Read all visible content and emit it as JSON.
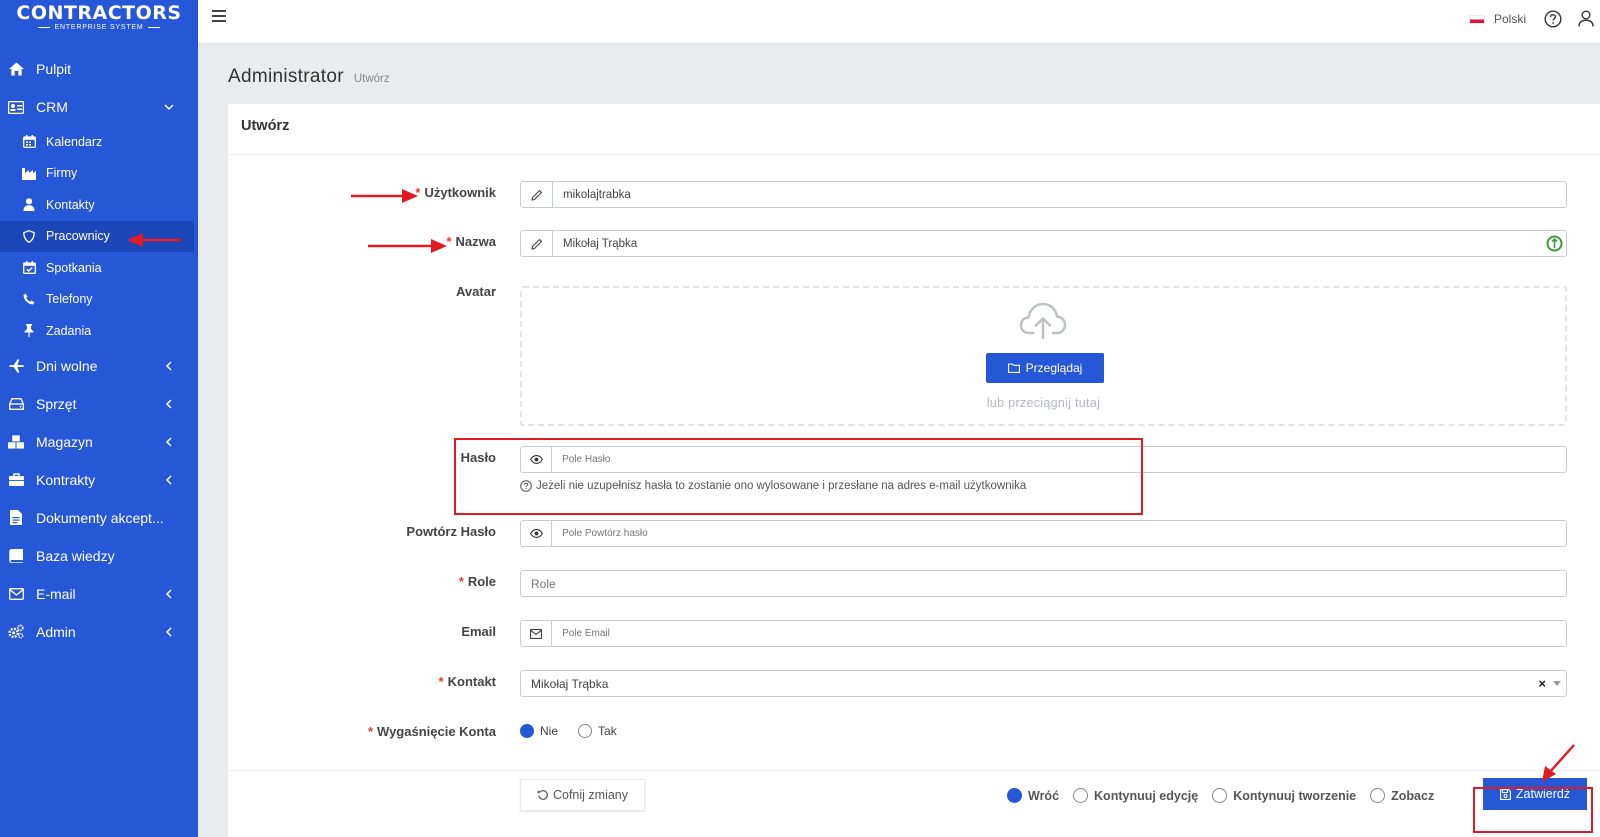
{
  "brand": {
    "name": "CONTRACTORS",
    "tagline": "ENTERPRISE SYSTEM"
  },
  "sidebar": {
    "items": [
      {
        "label": "Pulpit",
        "icon": "home-icon"
      },
      {
        "label": "CRM",
        "icon": "id-card-icon",
        "expanded": true
      },
      {
        "label": "Dni wolne",
        "icon": "plane-icon"
      },
      {
        "label": "Sprzęt",
        "icon": "hdd-icon"
      },
      {
        "label": "Magazyn",
        "icon": "boxes-icon"
      },
      {
        "label": "Kontrakty",
        "icon": "briefcase-icon"
      },
      {
        "label": "Dokumenty akcept...",
        "icon": "document-icon"
      },
      {
        "label": "Baza wiedzy",
        "icon": "book-icon"
      },
      {
        "label": "E-mail",
        "icon": "envelope-icon"
      },
      {
        "label": "Admin",
        "icon": "cogs-icon"
      }
    ],
    "crm_children": [
      {
        "label": "Kalendarz",
        "icon": "calendar-icon"
      },
      {
        "label": "Firmy",
        "icon": "industry-icon"
      },
      {
        "label": "Kontakty",
        "icon": "person-icon"
      },
      {
        "label": "Pracownicy",
        "icon": "shield-icon",
        "active": true
      },
      {
        "label": "Spotkania",
        "icon": "calendar-check-icon"
      },
      {
        "label": "Telefony",
        "icon": "phone-icon"
      },
      {
        "label": "Zadania",
        "icon": "thumbtack-icon"
      }
    ]
  },
  "topbar": {
    "language": "Polski",
    "flag_colors": [
      "#ffffff",
      "#dc143c"
    ]
  },
  "page": {
    "title": "Administrator",
    "subtitle": "Utwórz"
  },
  "card": {
    "title": "Utwórz"
  },
  "form": {
    "username": {
      "label": "Użytkownik",
      "value": "mikolajtrabka",
      "required": true
    },
    "name": {
      "label": "Nazwa",
      "value": "Mikołaj Trąbka",
      "required": true
    },
    "avatar": {
      "label": "Avatar",
      "browse_label": "Przeglądaj",
      "drop_hint": "lub przeciągnij tutaj"
    },
    "password": {
      "label": "Hasło",
      "placeholder": "Pole Hasło",
      "hint": "Jeżeli nie uzupełnisz hasła to zostanie ono wylosowane i przesłane na adres e-mail użytkownika"
    },
    "password_repeat": {
      "label": "Powtórz Hasło",
      "placeholder": "Pole Powtórz hasło"
    },
    "role": {
      "label": "Role",
      "placeholder": "Role",
      "required": true
    },
    "email": {
      "label": "Email",
      "placeholder": "Pole Email"
    },
    "contact": {
      "label": "Kontakt",
      "value": "Mikołaj Trąbka",
      "clear": "×",
      "required": true
    },
    "expiry": {
      "label": "Wygaśnięcie Konta",
      "required": true,
      "options": [
        "Nie",
        "Tak"
      ],
      "selected": "Nie"
    }
  },
  "footer": {
    "reset_label": "Cofnij zmiany",
    "after_save": {
      "options": [
        "Wróć",
        "Kontynuuj edycję",
        "Kontynuuj tworzenie",
        "Zobacz"
      ],
      "selected": "Wróć"
    },
    "submit_label": "Zatwierdź"
  },
  "colors": {
    "primary": "#2557d6",
    "active_item": "#1c47b8",
    "required": "#e53935",
    "annotation": "#e01b24"
  }
}
